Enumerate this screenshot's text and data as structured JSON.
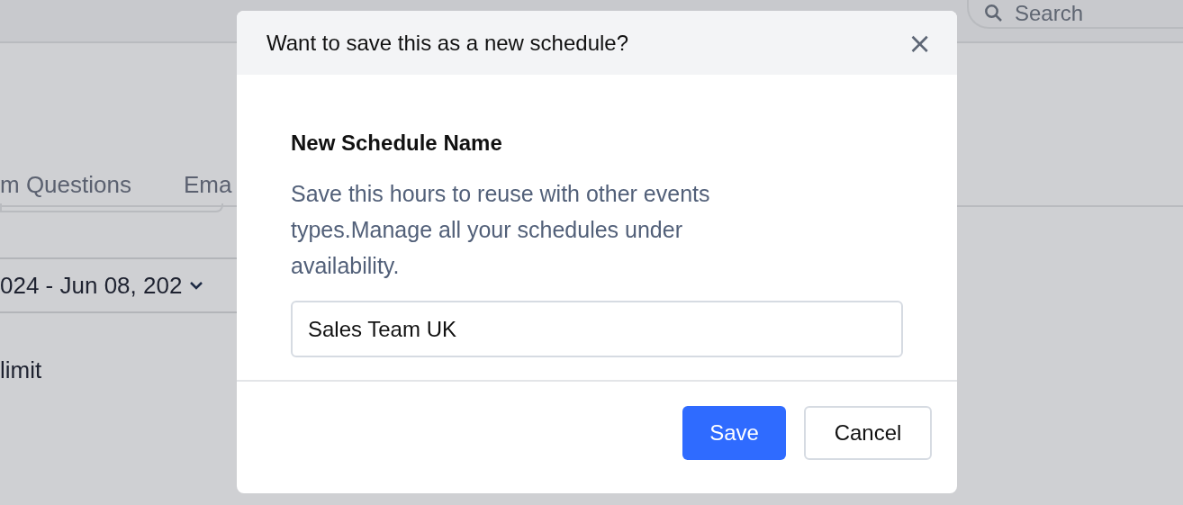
{
  "page": {
    "search": {
      "placeholder": "Search"
    },
    "tabs": [
      {
        "label": "m Questions"
      },
      {
        "label": "Ema"
      }
    ],
    "date_range": {
      "value": "024 - Jun 08, 202"
    },
    "limit_label": "limit"
  },
  "dialog": {
    "title": "Want to save this as a new schedule?",
    "close": "×",
    "field_label": "New Schedule Name",
    "description": "Save this hours to reuse with other events types.Manage all your schedules under availability.",
    "name_field": {
      "value": "Sales Team UK"
    },
    "buttons": [
      {
        "label": "Save",
        "kind": "primary"
      },
      {
        "label": "Cancel",
        "kind": "secondary"
      }
    ]
  }
}
